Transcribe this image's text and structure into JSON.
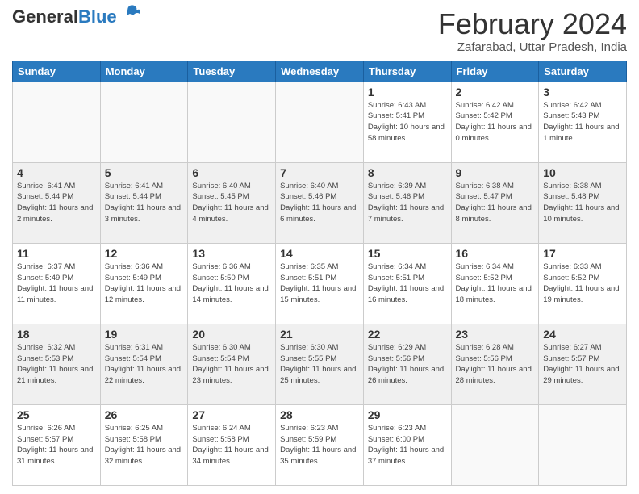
{
  "logo": {
    "general": "General",
    "blue": "Blue"
  },
  "title": "February 2024",
  "subtitle": "Zafarabad, Uttar Pradesh, India",
  "headers": [
    "Sunday",
    "Monday",
    "Tuesday",
    "Wednesday",
    "Thursday",
    "Friday",
    "Saturday"
  ],
  "weeks": [
    [
      {
        "day": "",
        "info": ""
      },
      {
        "day": "",
        "info": ""
      },
      {
        "day": "",
        "info": ""
      },
      {
        "day": "",
        "info": ""
      },
      {
        "day": "1",
        "info": "Sunrise: 6:43 AM\nSunset: 5:41 PM\nDaylight: 10 hours and 58 minutes."
      },
      {
        "day": "2",
        "info": "Sunrise: 6:42 AM\nSunset: 5:42 PM\nDaylight: 11 hours and 0 minutes."
      },
      {
        "day": "3",
        "info": "Sunrise: 6:42 AM\nSunset: 5:43 PM\nDaylight: 11 hours and 1 minute."
      }
    ],
    [
      {
        "day": "4",
        "info": "Sunrise: 6:41 AM\nSunset: 5:44 PM\nDaylight: 11 hours and 2 minutes."
      },
      {
        "day": "5",
        "info": "Sunrise: 6:41 AM\nSunset: 5:44 PM\nDaylight: 11 hours and 3 minutes."
      },
      {
        "day": "6",
        "info": "Sunrise: 6:40 AM\nSunset: 5:45 PM\nDaylight: 11 hours and 4 minutes."
      },
      {
        "day": "7",
        "info": "Sunrise: 6:40 AM\nSunset: 5:46 PM\nDaylight: 11 hours and 6 minutes."
      },
      {
        "day": "8",
        "info": "Sunrise: 6:39 AM\nSunset: 5:46 PM\nDaylight: 11 hours and 7 minutes."
      },
      {
        "day": "9",
        "info": "Sunrise: 6:38 AM\nSunset: 5:47 PM\nDaylight: 11 hours and 8 minutes."
      },
      {
        "day": "10",
        "info": "Sunrise: 6:38 AM\nSunset: 5:48 PM\nDaylight: 11 hours and 10 minutes."
      }
    ],
    [
      {
        "day": "11",
        "info": "Sunrise: 6:37 AM\nSunset: 5:49 PM\nDaylight: 11 hours and 11 minutes."
      },
      {
        "day": "12",
        "info": "Sunrise: 6:36 AM\nSunset: 5:49 PM\nDaylight: 11 hours and 12 minutes."
      },
      {
        "day": "13",
        "info": "Sunrise: 6:36 AM\nSunset: 5:50 PM\nDaylight: 11 hours and 14 minutes."
      },
      {
        "day": "14",
        "info": "Sunrise: 6:35 AM\nSunset: 5:51 PM\nDaylight: 11 hours and 15 minutes."
      },
      {
        "day": "15",
        "info": "Sunrise: 6:34 AM\nSunset: 5:51 PM\nDaylight: 11 hours and 16 minutes."
      },
      {
        "day": "16",
        "info": "Sunrise: 6:34 AM\nSunset: 5:52 PM\nDaylight: 11 hours and 18 minutes."
      },
      {
        "day": "17",
        "info": "Sunrise: 6:33 AM\nSunset: 5:52 PM\nDaylight: 11 hours and 19 minutes."
      }
    ],
    [
      {
        "day": "18",
        "info": "Sunrise: 6:32 AM\nSunset: 5:53 PM\nDaylight: 11 hours and 21 minutes."
      },
      {
        "day": "19",
        "info": "Sunrise: 6:31 AM\nSunset: 5:54 PM\nDaylight: 11 hours and 22 minutes."
      },
      {
        "day": "20",
        "info": "Sunrise: 6:30 AM\nSunset: 5:54 PM\nDaylight: 11 hours and 23 minutes."
      },
      {
        "day": "21",
        "info": "Sunrise: 6:30 AM\nSunset: 5:55 PM\nDaylight: 11 hours and 25 minutes."
      },
      {
        "day": "22",
        "info": "Sunrise: 6:29 AM\nSunset: 5:56 PM\nDaylight: 11 hours and 26 minutes."
      },
      {
        "day": "23",
        "info": "Sunrise: 6:28 AM\nSunset: 5:56 PM\nDaylight: 11 hours and 28 minutes."
      },
      {
        "day": "24",
        "info": "Sunrise: 6:27 AM\nSunset: 5:57 PM\nDaylight: 11 hours and 29 minutes."
      }
    ],
    [
      {
        "day": "25",
        "info": "Sunrise: 6:26 AM\nSunset: 5:57 PM\nDaylight: 11 hours and 31 minutes."
      },
      {
        "day": "26",
        "info": "Sunrise: 6:25 AM\nSunset: 5:58 PM\nDaylight: 11 hours and 32 minutes."
      },
      {
        "day": "27",
        "info": "Sunrise: 6:24 AM\nSunset: 5:58 PM\nDaylight: 11 hours and 34 minutes."
      },
      {
        "day": "28",
        "info": "Sunrise: 6:23 AM\nSunset: 5:59 PM\nDaylight: 11 hours and 35 minutes."
      },
      {
        "day": "29",
        "info": "Sunrise: 6:23 AM\nSunset: 6:00 PM\nDaylight: 11 hours and 37 minutes."
      },
      {
        "day": "",
        "info": ""
      },
      {
        "day": "",
        "info": ""
      }
    ]
  ]
}
